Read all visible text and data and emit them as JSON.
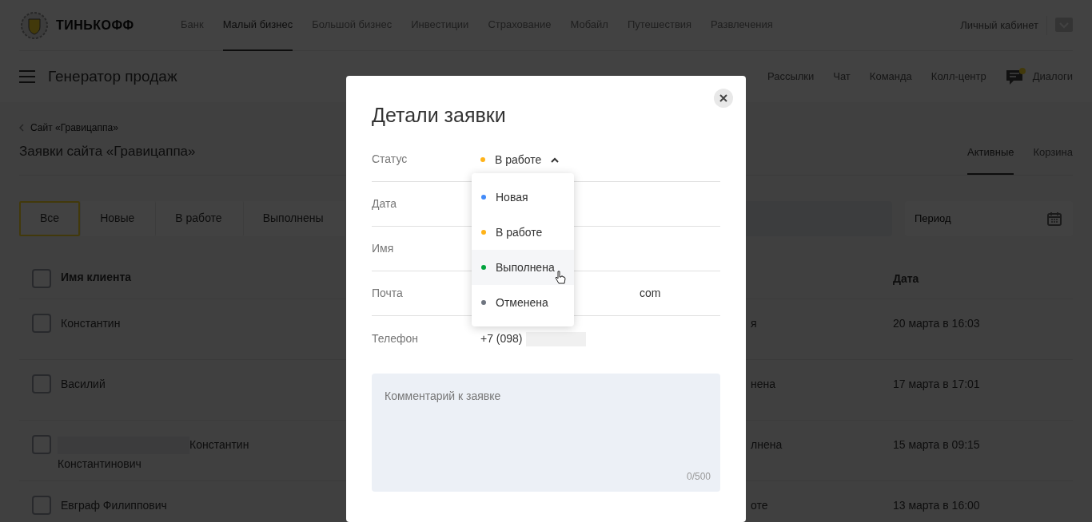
{
  "header": {
    "logo": "ТИНЬКОФФ",
    "nav": [
      {
        "label": "Банк",
        "selected": false
      },
      {
        "label": "Малый бизнес",
        "selected": true
      },
      {
        "label": "Большой бизнес",
        "selected": false
      },
      {
        "label": "Инвестиции",
        "selected": false
      },
      {
        "label": "Страхование",
        "selected": false
      },
      {
        "label": "Мобайл",
        "selected": false
      },
      {
        "label": "Путешествия",
        "selected": false
      },
      {
        "label": "Развлечения",
        "selected": false
      }
    ],
    "account": "Личный кабинет"
  },
  "subheader": {
    "title": "Генератор продаж",
    "nav": [
      "Рассылки",
      "Чат",
      "Команда",
      "Колл-центр"
    ],
    "dialogs": {
      "label": "Диалоги",
      "unread": true
    }
  },
  "breadcrumb": "Сайт «Гравицаппа»",
  "page_title": "Заявки сайта «Гравицаппа»",
  "view_tabs": [
    {
      "label": "Активные",
      "selected": true
    },
    {
      "label": "Корзина",
      "selected": false
    }
  ],
  "filters": [
    {
      "label": "Все",
      "selected": true
    },
    {
      "label": "Новые",
      "selected": false
    },
    {
      "label": "В работе",
      "selected": false
    },
    {
      "label": "Выполнены",
      "selected": false
    }
  ],
  "period": {
    "placeholder": "Период"
  },
  "table": {
    "columns": [
      "Имя клиента",
      "Дата"
    ],
    "header_checked": false,
    "rows": [
      {
        "checked": false,
        "name": "Константин",
        "redacted": false,
        "status": "я",
        "date": "20 марта в 16:03"
      },
      {
        "checked": false,
        "name": "Василий",
        "redacted": false,
        "status": "нена",
        "date": "17 марта в 17:01"
      },
      {
        "checked": false,
        "name": "Константин Константинович",
        "redacted": true,
        "status": "лнена",
        "date": "15 марта в 09:15"
      },
      {
        "checked": false,
        "name": "Евграф Филиппович",
        "redacted": false,
        "status": "оте",
        "date": "13 марта в 16:00"
      }
    ]
  },
  "modal": {
    "title": "Детали заявки",
    "fields": [
      {
        "label": "Статус",
        "kind": "status",
        "value": "В работе",
        "color": "#ffb319",
        "expanded": true
      },
      {
        "label": "Дата",
        "kind": "text"
      },
      {
        "label": "Имя",
        "kind": "text"
      },
      {
        "label": "Почта",
        "kind": "text",
        "value": "com"
      },
      {
        "label": "Телефон",
        "kind": "phone",
        "value": "+7 (098)",
        "redacted": true
      }
    ],
    "status_options": [
      {
        "label": "Новая",
        "color": "#428bf9",
        "hovered": false
      },
      {
        "label": "В работе",
        "color": "#ffb319",
        "hovered": false
      },
      {
        "label": "Выполнена",
        "color": "#00a33c",
        "hovered": true
      },
      {
        "label": "Отменена",
        "color": "#6f7580",
        "hovered": false
      }
    ],
    "comment": {
      "placeholder": "Комментарий к заявке",
      "counter": "0/500"
    }
  }
}
